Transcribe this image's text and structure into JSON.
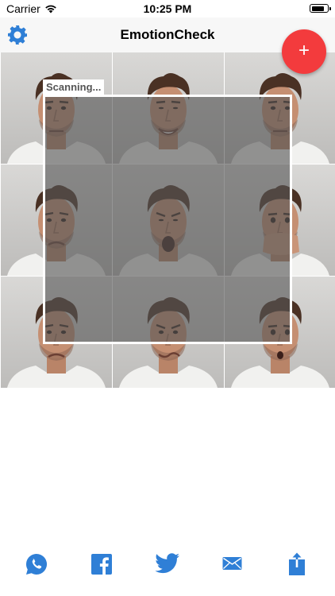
{
  "status_bar": {
    "carrier": "Carrier",
    "time": "10:25 PM",
    "battery_level": 0.85
  },
  "nav": {
    "title": "EmotionCheck",
    "settings_icon": "gear-icon",
    "add_label": "+"
  },
  "scan": {
    "label": "Scanning..."
  },
  "photos": [
    {
      "emotion": "neutral"
    },
    {
      "emotion": "happy"
    },
    {
      "emotion": "neutral"
    },
    {
      "emotion": "sad"
    },
    {
      "emotion": "scream"
    },
    {
      "emotion": "hand-over-mouth"
    },
    {
      "emotion": "sad"
    },
    {
      "emotion": "disgust"
    },
    {
      "emotion": "surprised"
    }
  ],
  "share": [
    {
      "name": "whatsapp-icon"
    },
    {
      "name": "facebook-icon"
    },
    {
      "name": "twitter-icon"
    },
    {
      "name": "mail-icon"
    },
    {
      "name": "share-icon"
    }
  ],
  "colors": {
    "accent": "#2f7fd6",
    "fab": "#f33b3d",
    "overlay": "#555555"
  }
}
